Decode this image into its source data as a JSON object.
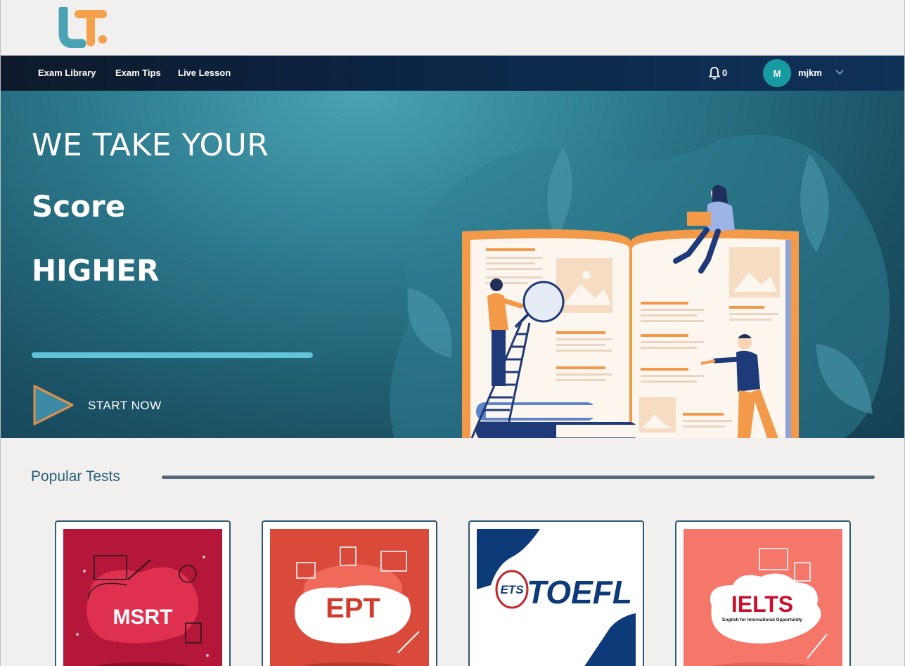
{
  "nav": {
    "links": [
      "Exam Library",
      "Exam Tips",
      "Live Lesson"
    ],
    "notification_count": "0",
    "user_initial": "M",
    "username": "mjkm"
  },
  "hero": {
    "line1": "WE TAKE YOUR",
    "line2": "Score",
    "line3": "HIGHER",
    "cta_label": "START NOW"
  },
  "popular": {
    "title": "Popular Tests",
    "cards": [
      {
        "name": "MSRT",
        "bg": "#b5173a",
        "blob": "#e0304f"
      },
      {
        "name": "EPT",
        "bg": "#d94a3a",
        "blob": "#ffffff"
      },
      {
        "name": "TOEFL",
        "prefix": "ETS",
        "bg": "#ffffff",
        "accent": "#0d3a78"
      },
      {
        "name": "IELTS",
        "subtitle": "English for International Opportunity",
        "bg": "#f5776a",
        "blob": "#ffffff"
      }
    ]
  },
  "colors": {
    "nav_bg": "#0b2546",
    "accent_teal": "#179aa1",
    "logo_teal": "#4aa3b3",
    "logo_orange": "#f5a04a"
  }
}
